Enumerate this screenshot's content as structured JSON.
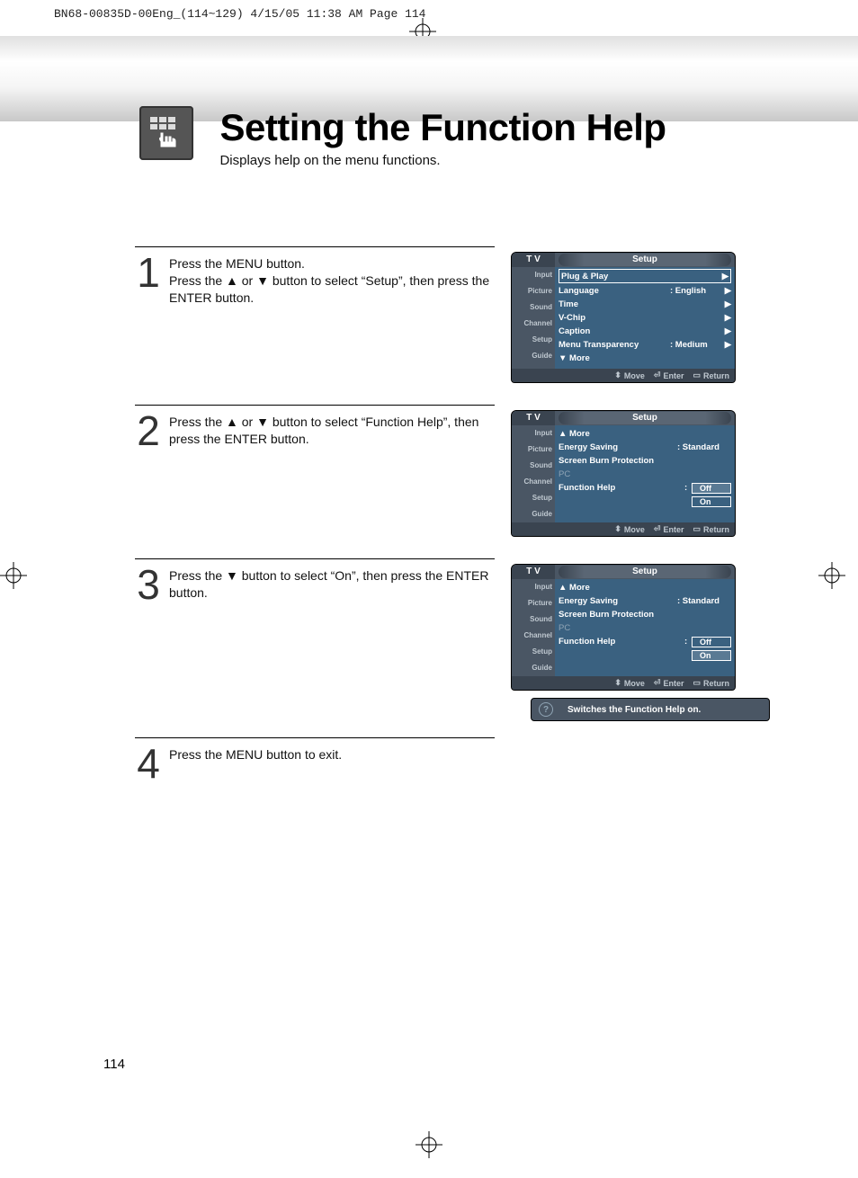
{
  "print_header": "BN68-00835D-00Eng_(114~129)  4/15/05  11:38 AM  Page 114",
  "title": "Setting the Function Help",
  "subtitle": "Displays help on the menu functions.",
  "steps": [
    {
      "num": "1",
      "text_parts": [
        "Press the MENU button.",
        "Press the ▲ or ▼ button to select “Setup”, then press the ENTER button."
      ]
    },
    {
      "num": "2",
      "text_parts": [
        "Press the ▲ or ▼ button to select “Function Help”, then press the ENTER button."
      ]
    },
    {
      "num": "3",
      "text_parts": [
        "Press the ▼ button to select “On”, then press the ENTER button."
      ]
    },
    {
      "num": "4",
      "text_parts": [
        "Press the MENU button to exit."
      ]
    }
  ],
  "osd": {
    "tv": "T V",
    "title": "Setup",
    "sidebar": [
      "Input",
      "Picture",
      "Sound",
      "Channel",
      "Setup",
      "Guide"
    ],
    "footer": {
      "move": "Move",
      "enter": "Enter",
      "return": "Return"
    },
    "screen1_rows": [
      {
        "lbl": "Plug & Play",
        "val": "",
        "arr": "▶",
        "boxed": true
      },
      {
        "lbl": "Language",
        "val": ": English",
        "arr": "▶"
      },
      {
        "lbl": "Time",
        "val": "",
        "arr": "▶"
      },
      {
        "lbl": "V-Chip",
        "val": "",
        "arr": "▶"
      },
      {
        "lbl": "Caption",
        "val": "",
        "arr": "▶"
      },
      {
        "lbl": "Menu Transparency",
        "val": ": Medium",
        "arr": "▶"
      },
      {
        "lbl": "▼ More",
        "val": "",
        "arr": ""
      }
    ],
    "screen2": {
      "more": "▲ More",
      "energy": {
        "lbl": "Energy Saving",
        "val": ": Standard"
      },
      "sbp": "Screen Burn Protection",
      "pc": "PC",
      "fh": {
        "lbl": "Function Help",
        "colon": ":"
      },
      "opts": {
        "off": "Off",
        "on": "On"
      },
      "selected": "Off"
    },
    "screen3": {
      "selected": "On"
    }
  },
  "help_bar": "Switches the Function Help on.",
  "page_num": "114"
}
